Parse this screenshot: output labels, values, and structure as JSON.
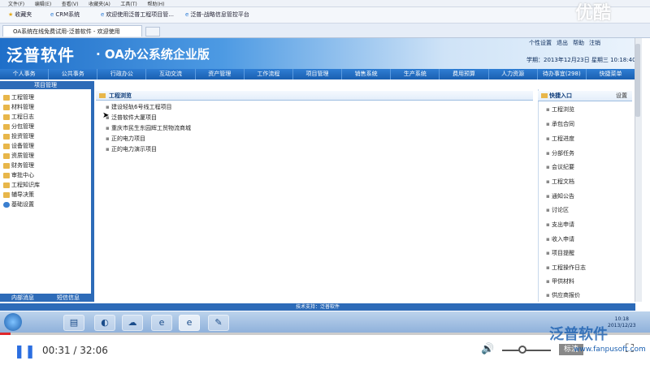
{
  "browser": {
    "menu": [
      "文件(F)",
      "编辑(E)",
      "查看(V)",
      "收藏夹(A)",
      "工具(T)",
      "帮助(H)"
    ],
    "favorites": [
      "收藏夹",
      "CRM系统",
      "欢迎使用泛普工程项目管...",
      "泛普-战略信息管控平台"
    ],
    "tab_title": "OA系统在线免费试用-泛普软件 - 欢迎使用"
  },
  "header": {
    "logo": "泛普软件",
    "subtitle": "· OA办公系统企业版",
    "date_line": "学期：2013年12月23日 星期三 10:18:40",
    "top_links": [
      "个性设置",
      "退出",
      "帮助",
      "注销"
    ]
  },
  "nav": [
    "个人事务",
    "公共事务",
    "行政办公",
    "互动交流",
    "资产管理",
    "工作流程",
    "项目管理",
    "销售系统",
    "生产系统",
    "费用预算",
    "人力资源",
    "待办事宜(298)",
    "快捷菜单"
  ],
  "sidebar": {
    "title": "项目管理",
    "items": [
      "工程管理",
      "材料管理",
      "工程日志",
      "分包管理",
      "投资管理",
      "设备管理",
      "资质管理",
      "财务管理",
      "审批中心",
      "工程知识库",
      "辅导决策",
      "基础设置"
    ],
    "bottom": [
      "内部消息",
      "短信信息"
    ]
  },
  "main": {
    "title": "工程浏览",
    "projects": [
      "建设轻轨6号线工程项目",
      "泛普软件大厦项目",
      "重庆市民生东园辉工贸物流商城",
      "正的电力项目",
      "正的电力演示项目"
    ]
  },
  "right": {
    "title": "快捷入口",
    "settings": "设置",
    "items": [
      "工程浏览",
      "承包合同",
      "工程进度",
      "分部任务",
      "会议纪要",
      "工程文档",
      "通知公告",
      "讨论区",
      "支出申请",
      "收入申请",
      "项目提醒",
      "工程操作日志",
      "甲供材料",
      "供应商报价"
    ]
  },
  "status_strip": "技术支持：泛普软件",
  "taskbar": {
    "clock_time": "10:18",
    "clock_date": "2013/12/23"
  },
  "player": {
    "time": "00:31 / 32:06",
    "quality": "标清",
    "progress": 0.016
  },
  "watermark": {
    "top": "优酷",
    "bottom": "泛普软件",
    "url": "www.fanpusoft.com"
  }
}
